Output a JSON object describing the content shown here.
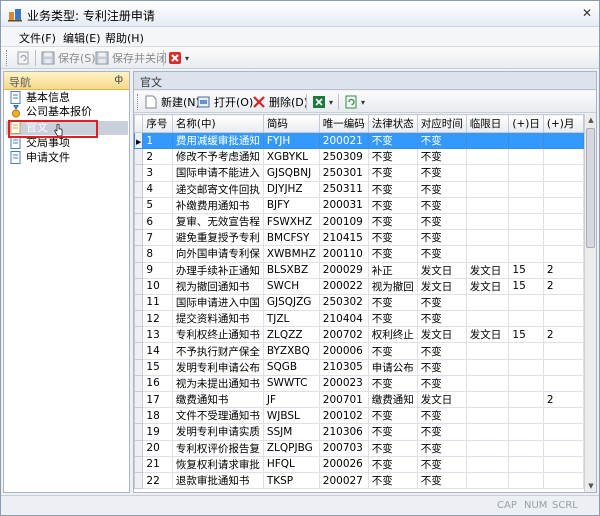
{
  "window": {
    "title": "业务类型: 专利注册申请"
  },
  "menu": [
    {
      "label": "文件(F)"
    },
    {
      "label": "编辑(E)"
    },
    {
      "label": "帮助(H)"
    }
  ],
  "toolbar": {
    "save_label": "保存(S)",
    "save_close_label": "保存并关闭"
  },
  "nav": {
    "title": "导航",
    "pin": "ф",
    "items": [
      {
        "label": "基本信息"
      },
      {
        "label": "公司基本报价"
      },
      {
        "label": "官文"
      },
      {
        "label": "交局事项"
      },
      {
        "label": "申请文件"
      }
    ]
  },
  "content": {
    "title": "官文",
    "toolbar": {
      "new_label": "新建(N)",
      "open_label": "打开(O)",
      "delete_label": "删除(D)"
    },
    "columns": [
      "序号",
      "名称(中)",
      "简码",
      "唯一编码",
      "法律状态",
      "对应时间",
      "临限日",
      "(+)日",
      "(+)月"
    ],
    "rows": [
      [
        "1",
        "费用减缓审批通知",
        "FYJH",
        "200021",
        "不变",
        "不变",
        "",
        "",
        ""
      ],
      [
        "2",
        "修改不予考虑通知",
        "XGBYKL",
        "250309",
        "不变",
        "不变",
        "",
        "",
        ""
      ],
      [
        "3",
        "国际申请不能进入",
        "GJSQBNJ",
        "250301",
        "不变",
        "不变",
        "",
        "",
        ""
      ],
      [
        "4",
        "递交邮寄文件回执",
        "DJYJHZ",
        "250311",
        "不变",
        "不变",
        "",
        "",
        ""
      ],
      [
        "5",
        "补缴费用通知书",
        "BJFY",
        "200031",
        "不变",
        "不变",
        "",
        "",
        ""
      ],
      [
        "6",
        "复审、无效宣告程",
        "FSWXHZ",
        "200109",
        "不变",
        "不变",
        "",
        "",
        ""
      ],
      [
        "7",
        "避免重复授予专利",
        "BMCFSY",
        "210415",
        "不变",
        "不变",
        "",
        "",
        ""
      ],
      [
        "8",
        "向外国申请专利保",
        "XWBMHZ",
        "200110",
        "不变",
        "不变",
        "",
        "",
        ""
      ],
      [
        "9",
        "办理手续补正通知",
        "BLSXBZ",
        "200029",
        "补正",
        "发文日",
        "发文日",
        "15",
        "2"
      ],
      [
        "10",
        "视为撤回通知书",
        "SWCH",
        "200022",
        "视为撤回",
        "发文日",
        "发文日",
        "15",
        "2"
      ],
      [
        "11",
        "国际申请进入中国",
        "GJSQJZG",
        "250302",
        "不变",
        "不变",
        "",
        "",
        ""
      ],
      [
        "12",
        "提交资料通知书",
        "TJZL",
        "210404",
        "不变",
        "不变",
        "",
        "",
        ""
      ],
      [
        "13",
        "专利权终止通知书",
        "ZLQZZ",
        "200702",
        "权利终止",
        "发文日",
        "发文日",
        "15",
        "2"
      ],
      [
        "14",
        "不予执行财产保全",
        "BYZXBQ",
        "200006",
        "不变",
        "不变",
        "",
        "",
        ""
      ],
      [
        "15",
        "发明专利申请公布",
        "SQGB",
        "210305",
        "申请公布",
        "不变",
        "",
        "",
        ""
      ],
      [
        "16",
        "视为未提出通知书",
        "SWWTC",
        "200023",
        "不变",
        "不变",
        "",
        "",
        ""
      ],
      [
        "17",
        "缴费通知书",
        "JF",
        "200701",
        "缴费通知",
        "发文日",
        "",
        "",
        "2"
      ],
      [
        "18",
        "文件不受理通知书",
        "WJBSL",
        "200102",
        "不变",
        "不变",
        "",
        "",
        ""
      ],
      [
        "19",
        "发明专利申请实质",
        "SSJM",
        "210306",
        "不变",
        "不变",
        "",
        "",
        ""
      ],
      [
        "20",
        "专利权评价报告复",
        "ZLQPJBG",
        "200703",
        "不变",
        "不变",
        "",
        "",
        ""
      ],
      [
        "21",
        "恢复权利请求审批",
        "HFQL",
        "200026",
        "不变",
        "不变",
        "",
        "",
        ""
      ],
      [
        "22",
        "退款审批通知书",
        "TKSP",
        "200027",
        "不变",
        "不变",
        "",
        "",
        ""
      ]
    ]
  },
  "statusbar": {
    "cap": "CAP",
    "num": "NUM",
    "scrl": "SCRL"
  },
  "colors": {
    "selected_row": "#3399ff",
    "nav_header": "#f5d98a",
    "highlight": "#e02020"
  }
}
